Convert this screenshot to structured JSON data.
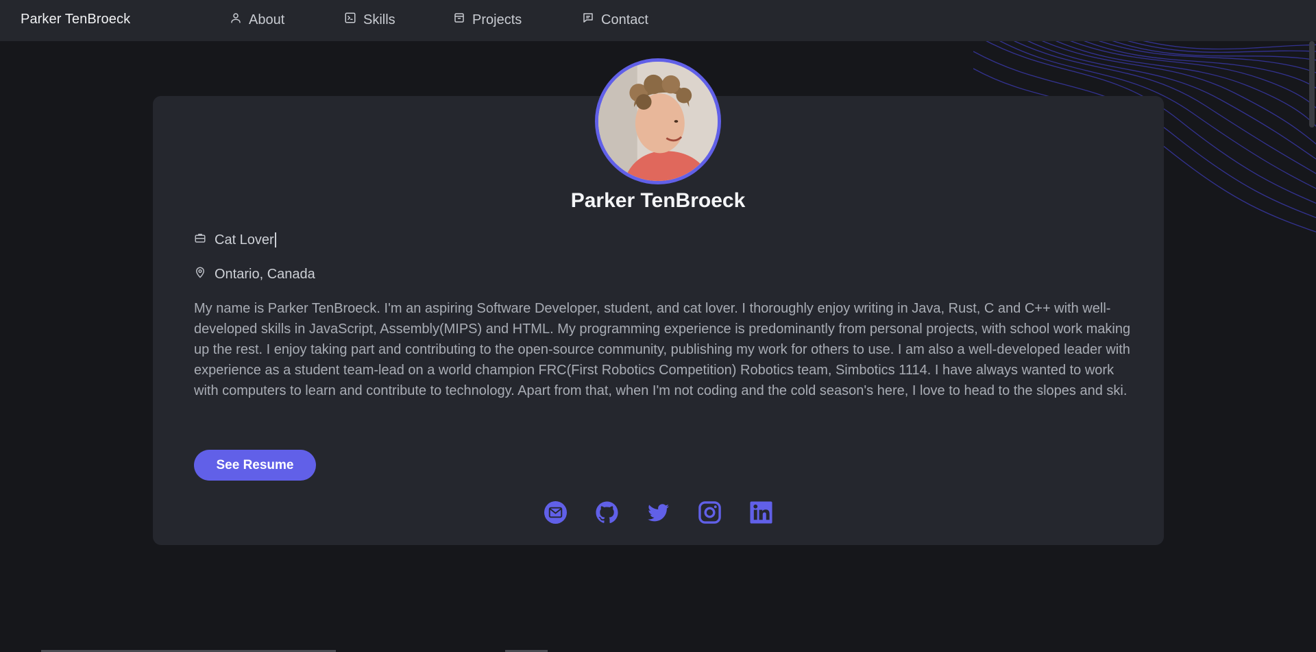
{
  "nav": {
    "brand": "Parker TenBroeck",
    "items": [
      {
        "label": "About",
        "icon": "user-icon"
      },
      {
        "label": "Skills",
        "icon": "terminal-icon"
      },
      {
        "label": "Projects",
        "icon": "archive-icon"
      },
      {
        "label": "Contact",
        "icon": "message-icon"
      }
    ]
  },
  "profile": {
    "name": "Parker TenBroeck",
    "avatar_alt": "Parker TenBroeck",
    "title": "Cat Lover",
    "location": "Ontario, Canada",
    "bio": "My name is Parker TenBroeck. I'm an aspiring Software Developer, student, and cat lover. I thoroughly enjoy writing in Java, Rust, C and C++ with well-developed skills in JavaScript, Assembly(MIPS) and HTML. My programming experience is predominantly from personal projects, with school work making up the rest. I enjoy taking part and contributing to the open-source community, publishing my work for others to use. I am also a well-developed leader with experience as a student team-lead on a world champion FRC(First Robotics Competition) Robotics team, Simbotics 1114. I have always wanted to work with computers to learn and contribute to technology. Apart from that, when I'm not coding and the cold season's here, I love to head to the slopes and ski.",
    "resume_label": "See Resume"
  },
  "socials": [
    {
      "name": "email",
      "icon": "mail-icon"
    },
    {
      "name": "github",
      "icon": "github-icon"
    },
    {
      "name": "twitter",
      "icon": "twitter-icon"
    },
    {
      "name": "instagram",
      "icon": "instagram-icon"
    },
    {
      "name": "linkedin",
      "icon": "linkedin-icon"
    }
  ],
  "colors": {
    "background": "#16171b",
    "navbar": "#25272d",
    "card": "#25272e",
    "accent": "#6160e8",
    "text_primary": "#f4f5f7",
    "text_secondary": "#a9adb5"
  }
}
